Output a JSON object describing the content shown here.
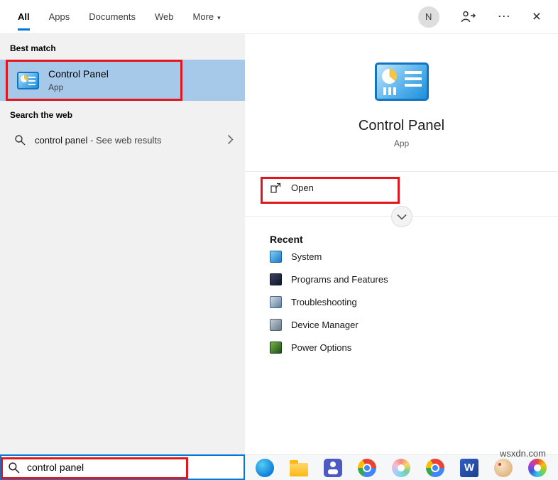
{
  "header": {
    "tabs": [
      {
        "label": "All"
      },
      {
        "label": "Apps"
      },
      {
        "label": "Documents"
      },
      {
        "label": "Web"
      },
      {
        "label": "More"
      }
    ],
    "more_caret": "▾",
    "avatar_initial": "N",
    "ellipsis": "⋯",
    "close": "×"
  },
  "left_panel": {
    "best_match_header": "Best match",
    "best_match": {
      "title": "Control Panel",
      "subtitle": "App"
    },
    "search_web_header": "Search the web",
    "web_result": {
      "query": "control panel",
      "suffix": " - See web results"
    },
    "search_input": {
      "value": "control panel"
    }
  },
  "right_panel": {
    "app_title": "Control Panel",
    "app_subtitle": "App",
    "open_label": "Open",
    "recent_header": "Recent",
    "recent_items": [
      {
        "label": "System",
        "icon": "system-icon"
      },
      {
        "label": "Programs and Features",
        "icon": "programs-and-features-icon"
      },
      {
        "label": "Troubleshooting",
        "icon": "troubleshooting-icon"
      },
      {
        "label": "Device Manager",
        "icon": "device-manager-icon"
      },
      {
        "label": "Power Options",
        "icon": "power-options-icon"
      }
    ]
  },
  "taskbar": {
    "icons": [
      "edge",
      "file-explorer",
      "teams",
      "chrome",
      "pinwheel",
      "chrome-2",
      "word",
      "paint",
      "color-wheel"
    ],
    "word_glyph": "W"
  },
  "watermark": "wsxdn.com",
  "colors": {
    "accent": "#0078d7",
    "highlight": "#a6c9ea",
    "annotation": "#e2161d"
  }
}
